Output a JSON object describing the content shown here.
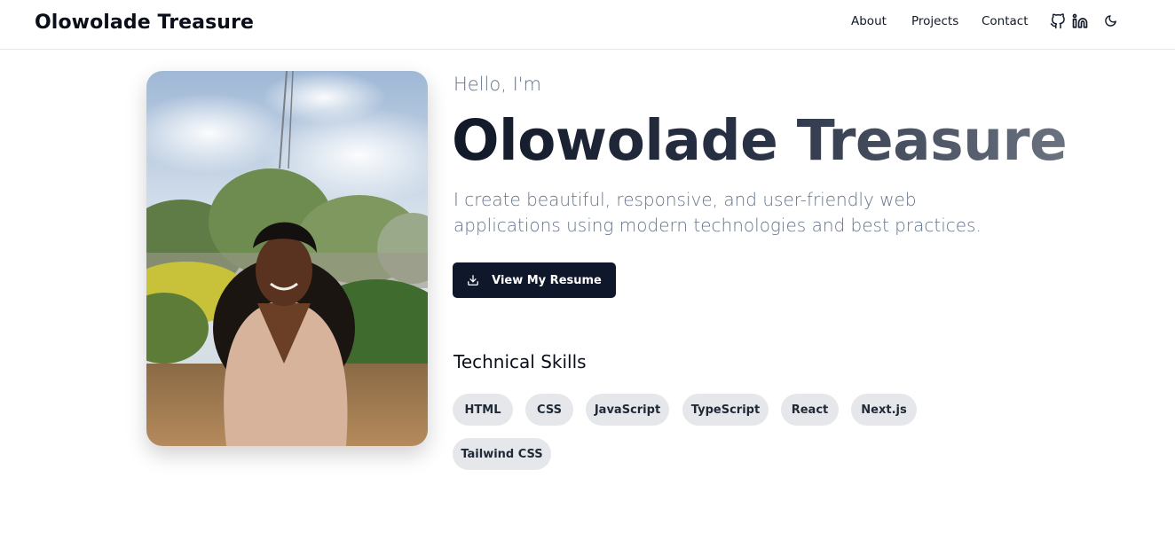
{
  "header": {
    "brand": "Olowolade Treasure",
    "nav": [
      {
        "label": "About"
      },
      {
        "label": "Projects"
      },
      {
        "label": "Contact"
      }
    ],
    "icons": [
      "github-icon",
      "linkedin-icon",
      "moon-icon"
    ]
  },
  "hero": {
    "photo_alt": "Portrait of Olowolade Treasure",
    "greeting": "Hello, I'm",
    "name": "Olowolade Treasure",
    "tagline": "I create beautiful, responsive, and user-friendly web applications using modern technologies and best practices.",
    "resume_button": "View My Resume",
    "resume_icon": "download-icon"
  },
  "skills": {
    "title": "Technical Skills",
    "items": [
      "HTML",
      "CSS",
      "JavaScript",
      "TypeScript",
      "React",
      "Next.js",
      "Tailwind CSS"
    ]
  },
  "colors": {
    "primary_dark": "#0f172a",
    "muted_text": "#64748b",
    "chip_bg": "#e5e7eb"
  }
}
